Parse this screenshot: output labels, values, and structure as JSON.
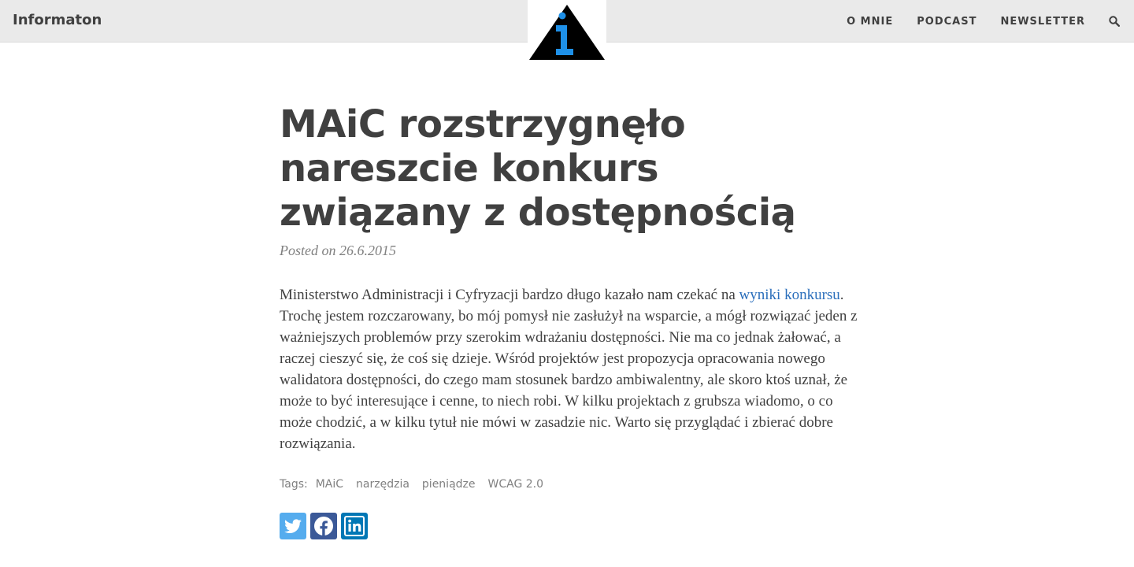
{
  "header": {
    "brand": "Informaton",
    "nav": [
      "O MNIE",
      "PODCAST",
      "NEWSLETTER"
    ],
    "search_icon": "search-icon",
    "logo_colors": {
      "triangle": "#000000",
      "info": "#1e90e8"
    }
  },
  "post": {
    "title": "MAiC rozstrzygnęło nareszcie konkurs związany z dostępnością",
    "meta_prefix": "Posted on",
    "date": "26.6.2015",
    "body": {
      "before_link": "Ministerstwo Administracji i Cyfryzacji bardzo długo kazało nam czekać na ",
      "link_text": "wyniki konkursu",
      "after_link": ". Trochę jestem rozczarowany, bo mój pomysł nie zasłużył na wsparcie, a mógł rozwiązać jeden z ważniejszych problemów przy szerokim wdrażaniu dostępności. Nie ma co jednak żałować, a raczej cieszyć się, że coś się dzieje. Wśród projektów jest propozycja opracowania nowego walidatora dostępności, do czego mam stosunek bardzo ambiwalentny, ale skoro ktoś uznał, że może to być interesujące i cenne, to niech robi. W kilku projektach z grubsza wiadomo, o co może chodzić, a w kilku tytuł nie mówi w zasadzie nic. Warto się przyglądać i zbierać dobre rozwiązania."
    },
    "tags_label": "Tags:",
    "tags": [
      "MAiC",
      "narzędzia",
      "pieniądze",
      "WCAG 2.0"
    ],
    "share": [
      {
        "icon": "twitter-icon",
        "color": "#55acee"
      },
      {
        "icon": "facebook-icon",
        "color": "#3b5998"
      },
      {
        "icon": "linkedin-icon",
        "color": "#0077b5"
      }
    ]
  }
}
